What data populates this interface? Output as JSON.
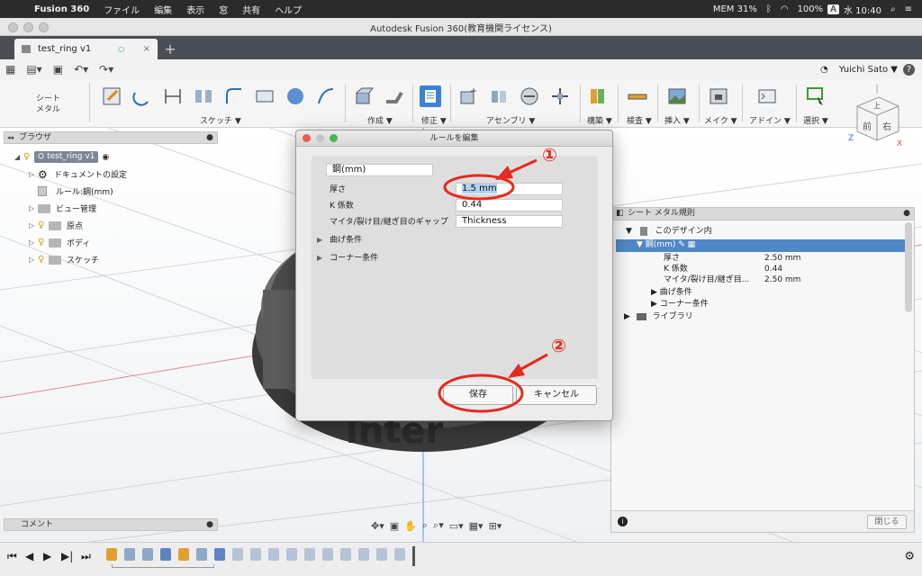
{
  "menubar": {
    "app": "Fusion 360",
    "items": [
      "ファイル",
      "編集",
      "表示",
      "窓",
      "共有",
      "ヘルプ"
    ],
    "status": {
      "mem": "MEM 31%",
      "battery": "100%",
      "input": "A",
      "clock": "水 10:40"
    }
  },
  "window": {
    "title": "Autodesk Fusion 360(教育機関ライセンス)"
  },
  "tab": {
    "name": "test_ring v1"
  },
  "user": {
    "name": "Yuichi Sato ▼",
    "help": "?"
  },
  "toolbar": {
    "workspace": [
      "シート",
      "メタル"
    ],
    "groups": [
      "スケッチ ▼",
      "作成 ▼",
      "修正 ▼",
      "アセンブリ ▼",
      "構築 ▼",
      "検査 ▼",
      "挿入 ▼",
      "メイク ▼",
      "アドイン ▼",
      "選択 ▼"
    ]
  },
  "viewcube": {
    "front": "前",
    "right": "右",
    "top": "上",
    "z": "Z",
    "x": "X"
  },
  "browser": {
    "title": "ブラウザ",
    "root": "test_ring v1",
    "items": [
      {
        "label": "ドキュメントの設定"
      },
      {
        "label": "ルール:鋼(mm)"
      },
      {
        "label": "ビュー管理"
      },
      {
        "label": "原点"
      },
      {
        "label": "ボディ"
      },
      {
        "label": "スケッチ"
      }
    ]
  },
  "comment": {
    "title": "コメント"
  },
  "dialog": {
    "title": "ルールを編集",
    "rule_name": "鋼(mm)",
    "fields": [
      {
        "label": "厚さ",
        "value": "1.5 mm"
      },
      {
        "label": "K 係数",
        "value": "0.44"
      },
      {
        "label": "マイタ/裂け目/継ぎ目のギャップ",
        "value": "Thickness"
      }
    ],
    "sections": [
      "曲げ条件",
      "コーナー条件"
    ],
    "save": "保存",
    "cancel": "キャンセル"
  },
  "rules_panel": {
    "title": "シート メタル規則",
    "in_design": "このデザイン内",
    "rule": "鋼(mm)",
    "props": [
      {
        "label": "厚さ",
        "value": "2.50 mm"
      },
      {
        "label": "K 係数",
        "value": "0.44"
      },
      {
        "label": "マイタ/裂け目/継ぎ目...",
        "value": "2.50 mm"
      }
    ],
    "sections": [
      "曲げ条件",
      "コーナー条件"
    ],
    "library": "ライブラリ",
    "close": "閉じる"
  },
  "annotations": [
    "①",
    "②"
  ],
  "colors": {
    "accent": "#e52a1e",
    "selection": "#4f88c8",
    "tabbar": "#4a4f57"
  }
}
